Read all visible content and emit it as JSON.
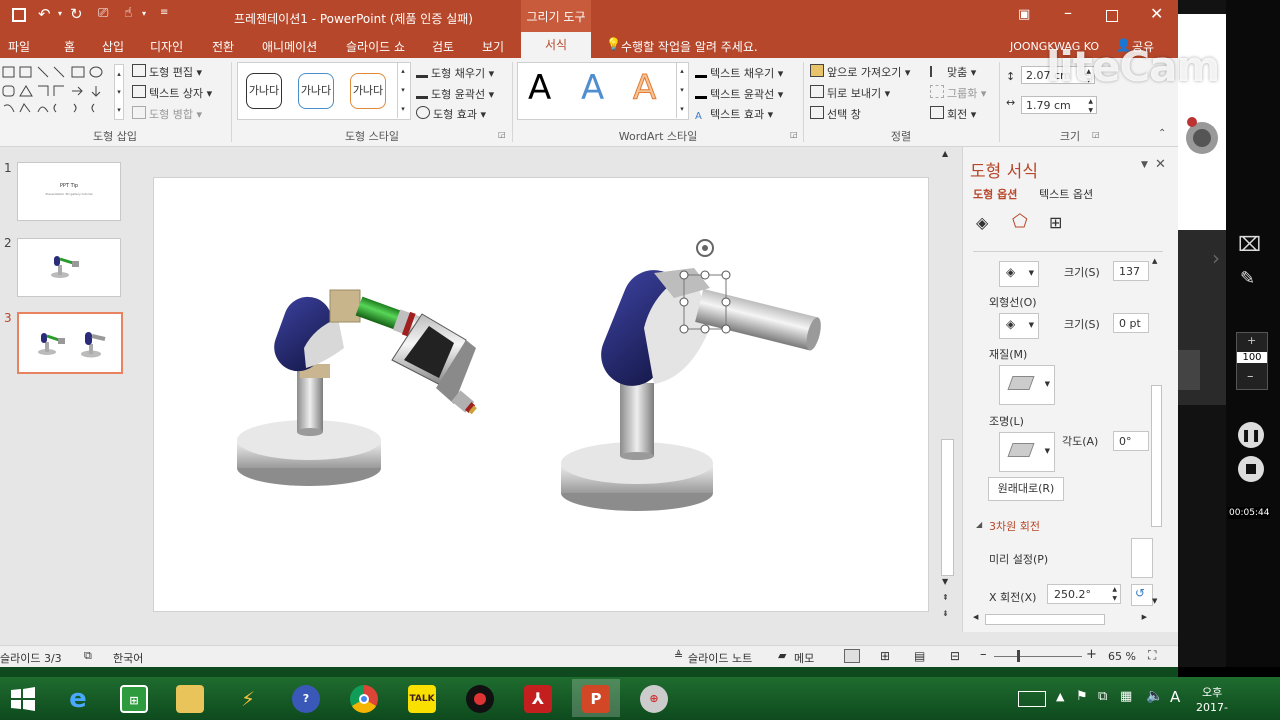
{
  "window": {
    "title": "프레젠테이션1 - PowerPoint (제품 인증 실패)",
    "context_tab": "그리기 도구",
    "user": "JOONGKWAG KO",
    "share": "공유"
  },
  "tabs": [
    "파일",
    "홈",
    "삽입",
    "디자인",
    "전환",
    "애니메이션",
    "슬라이드 쇼",
    "검토",
    "보기",
    "서식"
  ],
  "tell_me": "수행할 작업을 알려 주세요.",
  "ribbon": {
    "insert_shapes": {
      "label": "도형 삽입",
      "edit_shape": "도형 편집",
      "text_box": "텍스트 상자",
      "merge_shapes": "도형 병합"
    },
    "shape_styles": {
      "label": "도형 스타일",
      "sample": "가나다",
      "fill": "도형 채우기",
      "outline": "도형 윤곽선",
      "effects": "도형 효과"
    },
    "wordart": {
      "label": "WordArt 스타일",
      "letter": "A",
      "text_fill": "텍스트 채우기",
      "text_outline": "텍스트 윤곽선",
      "text_effects": "텍스트 효과"
    },
    "arrange": {
      "label": "정렬",
      "bring_forward": "앞으로 가져오기",
      "send_backward": "뒤로 보내기",
      "selection_pane": "선택 창",
      "align": "맞춤",
      "group": "그룹화",
      "rotate": "회전"
    },
    "size": {
      "label": "크기",
      "height": "2.07 cm",
      "width": "1.79 cm"
    }
  },
  "slides": [
    {
      "number": "1",
      "title": "PPT Tip",
      "subtitle": "Presentation 3D gallery tutorial"
    },
    {
      "number": "2"
    },
    {
      "number": "3"
    }
  ],
  "pane": {
    "title": "도형 서식",
    "tab_shape": "도형 옵션",
    "tab_text": "텍스트 옵션",
    "size_label": "크기(S)",
    "size_value": "137 p",
    "outline_label": "외형선(O)",
    "outline_size_label": "크기(S)",
    "outline_size_value": "0 pt",
    "material_label": "재질(M)",
    "lighting_label": "조명(L)",
    "angle_label": "각도(A)",
    "angle_value": "0°",
    "reset": "원래대로(R)",
    "rotation_section": "3차원 회전",
    "presets": "미리 설정(P)",
    "x_rotation_label": "X 회전(X)",
    "x_rotation_value": "250.2°"
  },
  "status": {
    "slide": "슬라이드 3/3",
    "language": "한국어",
    "notes": "슬라이드 노트",
    "comments": "메모",
    "zoom": "65 %"
  },
  "overlay": {
    "watermark": "liteCam",
    "zoom_value": "100",
    "timer": "00:05:44"
  },
  "taskbar": {
    "clock_top": "오후",
    "clock_bottom": "2017-",
    "ime": "A"
  },
  "colors": {
    "accent": "#b7472a",
    "context": "#c75b3c",
    "taskbar": "#1a6a2c"
  }
}
